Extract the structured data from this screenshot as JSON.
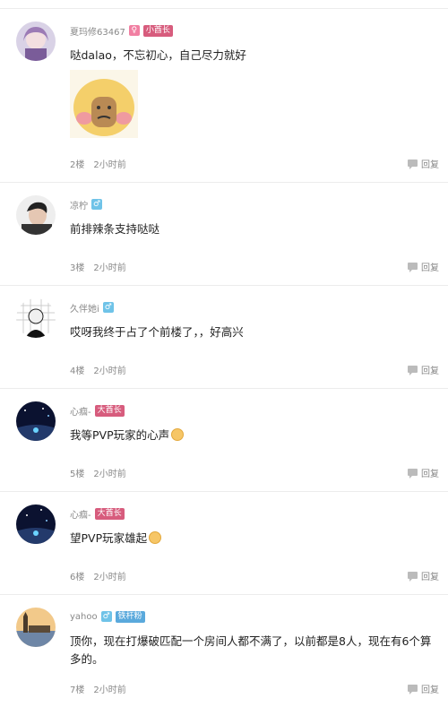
{
  "comments": [
    {
      "user": "夏玛修63467",
      "gender": "♀",
      "badge": "小酋长",
      "badge_color": "pink",
      "text": "哒dalao，不忘初心，自己尽力就好",
      "has_sticker": true,
      "floor": "2楼",
      "time": "2小时前",
      "reply": "回复"
    },
    {
      "user": "凉柠",
      "gender": "♂",
      "badge": "",
      "text": "前排辣条支持哒哒",
      "floor": "3楼",
      "time": "2小时前",
      "reply": "回复"
    },
    {
      "user": "久伴她i",
      "gender": "♂",
      "badge": "",
      "text": "哎呀我终于占了个前楼了，，好高兴",
      "floor": "4楼",
      "time": "2小时前",
      "reply": "回复"
    },
    {
      "user": "心痼-",
      "gender": "",
      "badge": "大酋长",
      "badge_color": "pink",
      "text": "我等PVP玩家的心声",
      "has_emoji": true,
      "floor": "5楼",
      "time": "2小时前",
      "reply": "回复"
    },
    {
      "user": "心痼-",
      "gender": "",
      "badge": "大酋长",
      "badge_color": "pink",
      "text": "望PVP玩家雄起",
      "has_emoji": true,
      "floor": "6楼",
      "time": "2小时前",
      "reply": "回复"
    },
    {
      "user": "yahoo",
      "gender": "♂",
      "badge": "铁杆粉",
      "badge_color": "blue",
      "text": "顶你，现在打爆破匹配一个房间人都不满了，以前都是8人，现在有6个算多的。",
      "floor": "7楼",
      "time": "2小时前",
      "reply": "回复"
    }
  ]
}
